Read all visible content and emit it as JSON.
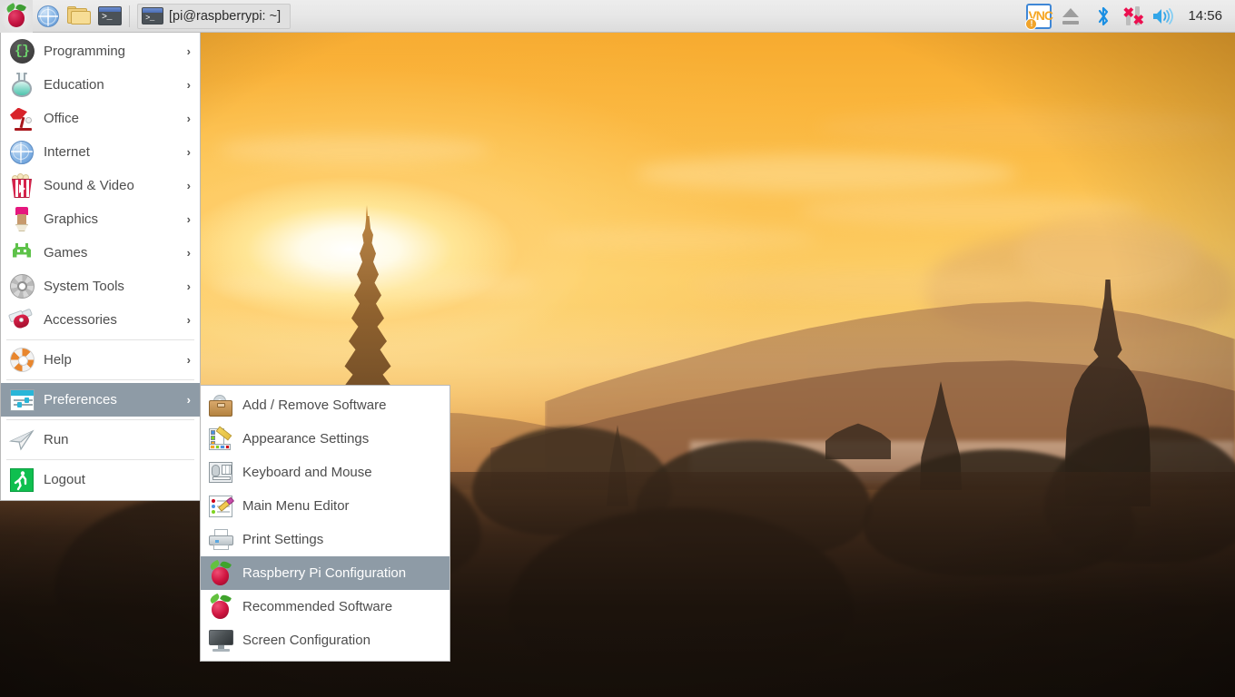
{
  "taskbar": {
    "launcher": {
      "name": "raspberry-menu",
      "tooltip": "Menu"
    },
    "quick_launch": [
      {
        "name": "web-browser-icon",
        "label": "Web Browser"
      },
      {
        "name": "file-manager-icon",
        "label": "File Manager"
      },
      {
        "name": "terminal-icon",
        "label": "Terminal"
      }
    ],
    "windows": [
      {
        "name": "terminal-window-button",
        "label": "[pi@raspberrypi: ~]",
        "active": true
      }
    ],
    "tray": [
      {
        "name": "vnc-icon",
        "label": "VNC",
        "badge": "!"
      },
      {
        "name": "eject-icon",
        "label": "Eject"
      },
      {
        "name": "bluetooth-icon",
        "label": "Bluetooth"
      },
      {
        "name": "network-icon",
        "label": "Network (disconnected)"
      },
      {
        "name": "volume-icon",
        "label": "Volume"
      }
    ],
    "clock": "14:56"
  },
  "main_menu": {
    "items": [
      {
        "label": "Programming",
        "icon": "code-icon",
        "arrow": "›",
        "selected": false
      },
      {
        "label": "Education",
        "icon": "flask-icon",
        "arrow": "›",
        "selected": false
      },
      {
        "label": "Office",
        "icon": "desk-lamp-icon",
        "arrow": "›",
        "selected": false
      },
      {
        "label": "Internet",
        "icon": "globe-icon",
        "arrow": "›",
        "selected": false
      },
      {
        "label": "Sound & Video",
        "icon": "popcorn-icon",
        "arrow": "›",
        "selected": false
      },
      {
        "label": "Graphics",
        "icon": "paintbrush-icon",
        "arrow": "›",
        "selected": false
      },
      {
        "label": "Games",
        "icon": "alien-invader-icon",
        "arrow": "›",
        "selected": false
      },
      {
        "label": "System Tools",
        "icon": "gear-icon",
        "arrow": "›",
        "selected": false
      },
      {
        "label": "Accessories",
        "icon": "swiss-knife-icon",
        "arrow": "›",
        "selected": false
      },
      {
        "label": "Help",
        "icon": "lifebuoy-icon",
        "arrow": "›",
        "selected": false
      },
      {
        "label": "Preferences",
        "icon": "sliders-icon",
        "arrow": "›",
        "selected": true
      },
      {
        "label": "Run",
        "icon": "paper-plane-icon",
        "arrow": "",
        "selected": false
      },
      {
        "label": "Logout",
        "icon": "exit-runner-icon",
        "arrow": "",
        "selected": false
      }
    ]
  },
  "submenu": {
    "parent": "Preferences",
    "items": [
      {
        "label": "Add / Remove Software",
        "icon": "software-briefcase-icon",
        "selected": false
      },
      {
        "label": "Appearance Settings",
        "icon": "appearance-icon",
        "selected": false
      },
      {
        "label": "Keyboard and Mouse",
        "icon": "keyboard-mouse-icon",
        "selected": false
      },
      {
        "label": "Main Menu Editor",
        "icon": "menu-editor-icon",
        "selected": false
      },
      {
        "label": "Print Settings",
        "icon": "printer-icon",
        "selected": false
      },
      {
        "label": "Raspberry Pi Configuration",
        "icon": "raspberry-icon",
        "selected": true
      },
      {
        "label": "Recommended Software",
        "icon": "raspberry-icon",
        "selected": false
      },
      {
        "label": "Screen Configuration",
        "icon": "monitor-icon",
        "selected": false
      }
    ]
  },
  "desktop": {
    "wallpaper_name": "bagan-sunrise-pagodas",
    "description": "Sunrise over Bagan temples silhouette"
  },
  "colors": {
    "menu_highlight": "#8e9ba6",
    "menu_background": "#ffffff",
    "menu_text": "#4d4d4d",
    "menu_text_selected": "#ffffff",
    "taskbar_background": "#e7e7e7",
    "taskbar_text": "#2b2b2b",
    "accent_vnc": "#f5a623",
    "accent_bluetooth": "#1a8fe3",
    "accent_network_error": "#ec0f4f",
    "sky_top": "#f5a62c",
    "sun_core": "#ffffff"
  }
}
